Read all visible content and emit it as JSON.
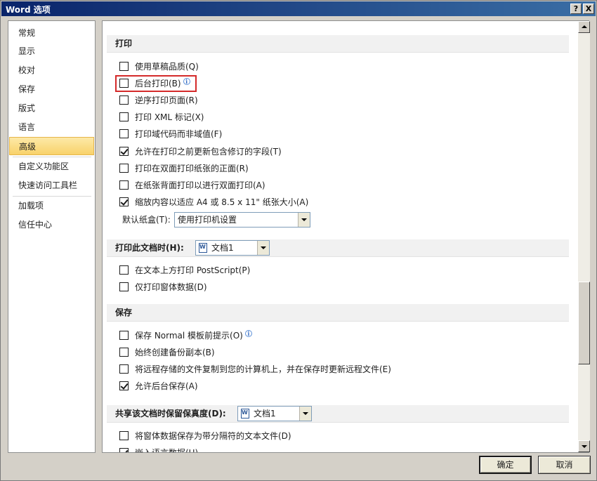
{
  "window": {
    "title": "Word 选项",
    "help_button": "?",
    "close_button": "X"
  },
  "nav": {
    "items": [
      {
        "label": "常规"
      },
      {
        "label": "显示"
      },
      {
        "label": "校对"
      },
      {
        "label": "保存"
      },
      {
        "label": "版式"
      },
      {
        "label": "语言"
      },
      {
        "label": "高级",
        "active": true
      },
      {
        "label": "自定义功能区"
      },
      {
        "label": "快速访问工具栏"
      },
      {
        "label": "加载项"
      },
      {
        "label": "信任中心"
      }
    ]
  },
  "print_section": {
    "header": "打印",
    "options": [
      {
        "label": "使用草稿品质(Q)",
        "checked": false
      },
      {
        "label": "后台打印(B)",
        "checked": false,
        "info_icon": true
      },
      {
        "label": "逆序打印页面(R)",
        "checked": false
      },
      {
        "label": "打印 XML 标记(X)",
        "checked": false
      },
      {
        "label": "打印域代码而非域值(F)",
        "checked": false
      },
      {
        "label": "允许在打印之前更新包含修订的字段(T)",
        "checked": true
      },
      {
        "label": "打印在双面打印纸张的正面(R)",
        "checked": false
      },
      {
        "label": "在纸张背面打印以进行双面打印(A)",
        "checked": false
      },
      {
        "label": "缩放内容以适应 A4 或 8.5 x 11\" 纸张大小(A)",
        "checked": true
      }
    ],
    "tray_label": "默认纸盒(T):",
    "tray_value": "使用打印机设置"
  },
  "print_doc_section": {
    "header": "打印此文档时(H):",
    "doc_value": "文档1",
    "options": [
      {
        "label": "在文本上方打印 PostScript(P)",
        "checked": false
      },
      {
        "label": "仅打印窗体数据(D)",
        "checked": false
      }
    ]
  },
  "save_section": {
    "header": "保存",
    "options": [
      {
        "label": "保存 Normal 模板前提示(O)",
        "checked": false,
        "info_icon": true
      },
      {
        "label": "始终创建备份副本(B)",
        "checked": false
      },
      {
        "label": "将远程存储的文件复制到您的计算机上，并在保存时更新远程文件(E)",
        "checked": false
      },
      {
        "label": "允许后台保存(A)",
        "checked": true
      }
    ]
  },
  "share_section": {
    "header": "共享该文档时保留保真度(D):",
    "doc_value": "文档1",
    "options": [
      {
        "label": "将窗体数据保存为带分隔符的文本文件(D)",
        "checked": false
      },
      {
        "label": "嵌入语言数据(U)",
        "checked": true
      }
    ]
  },
  "footer": {
    "ok": "确定",
    "cancel": "取消"
  },
  "icons": {
    "info": "info-icon",
    "document": "word-document-icon"
  }
}
